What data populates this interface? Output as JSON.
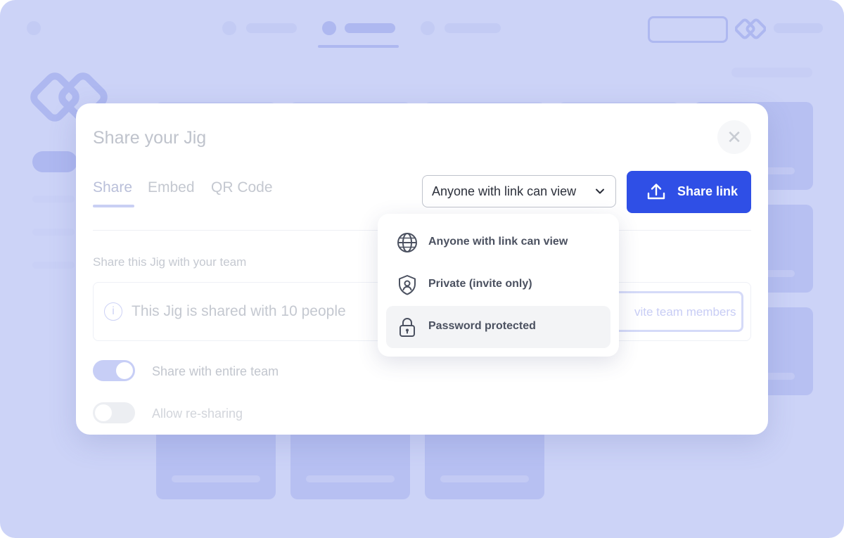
{
  "modal": {
    "title": "Share your Jig",
    "close_icon": "close-icon",
    "tabs": [
      {
        "label": "Share",
        "active": true
      },
      {
        "label": "Embed",
        "active": false
      },
      {
        "label": "QR Code",
        "active": false
      }
    ],
    "access_select": {
      "value": "Anyone with link can view"
    },
    "share_button": {
      "label": "Share link",
      "icon": "upload-icon"
    },
    "section_label": "Share this Jig with your team",
    "info": {
      "text": "This Jig is shared with 10 people",
      "invite_label": "vite team members"
    },
    "toggles": [
      {
        "label": "Share with entire team",
        "on": true
      },
      {
        "label": "Allow re-sharing",
        "on": false
      }
    ]
  },
  "dropdown": {
    "options": [
      {
        "label": "Anyone with link can view",
        "icon": "globe-icon",
        "highlighted": false
      },
      {
        "label": "Private (invite only)",
        "icon": "shield-user-icon",
        "highlighted": false
      },
      {
        "label": "Password protected",
        "icon": "lock-icon",
        "highlighted": true
      }
    ]
  },
  "colors": {
    "backdrop": "#ccd3f7",
    "accent": "#2f4fe6",
    "text": "#2b2f3a"
  }
}
